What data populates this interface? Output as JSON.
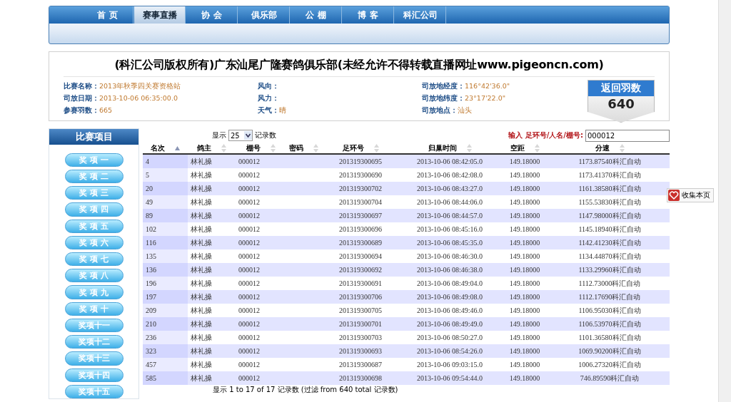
{
  "nav": [
    {
      "label": "首 页",
      "selected": false
    },
    {
      "label": "赛事直播",
      "selected": true
    },
    {
      "label": "协 会",
      "selected": false
    },
    {
      "label": "俱乐部",
      "selected": false
    },
    {
      "label": "公 棚",
      "selected": false
    },
    {
      "label": "博 客",
      "selected": false
    },
    {
      "label": "科汇公司",
      "selected": false
    }
  ],
  "header": {
    "title": "(科汇公司版权所有)广东汕尾广隆赛鸽俱乐部(未经允许不得转载直播网址www.pigeoncn.com)",
    "info": [
      {
        "label": "比赛名称：",
        "value": "2013年秋季四关赛资格站"
      },
      {
        "label": "风向："
      },
      {
        "label": "司放地经度：",
        "value": "116°42'36.0\""
      },
      {
        "label": "司放日期：",
        "value": "2013-10-06 06:35:00.0"
      },
      {
        "label": "风力："
      },
      {
        "label": "司放地纬度：",
        "value": "23°17'22.0\""
      },
      {
        "label": "参赛羽数：",
        "value": "665"
      },
      {
        "label": "天气：",
        "value": "晴"
      },
      {
        "label": "司放地点：",
        "value": "汕头"
      }
    ],
    "badge": {
      "title": "返回羽数",
      "count": "640"
    }
  },
  "sidebar": {
    "title": "比赛项目",
    "items": [
      "奖 项 一",
      "奖 项 二",
      "奖 项 三",
      "奖 项 四",
      "奖 项 五",
      "奖 项 六",
      "奖 项 七",
      "奖 项 八",
      "奖 项 九",
      "奖 项 十",
      "奖项十一",
      "奖项十二",
      "奖项十三",
      "奖项十四",
      "奖项十五"
    ]
  },
  "table": {
    "length_label_before": "显示",
    "length_value": "25",
    "length_label_after": "记录数",
    "search_label": "输入 足环号/人名/棚号:",
    "search_value": "000012",
    "columns": [
      {
        "label": "名次",
        "sorted": true
      },
      {
        "label": "鸽主",
        "sorted": false
      },
      {
        "label": "棚号",
        "sorted": false
      },
      {
        "label": "密码",
        "sorted": false
      },
      {
        "label": "足环号",
        "sorted": false
      },
      {
        "label": "归巢时间",
        "sorted": false
      },
      {
        "label": "空距",
        "sorted": false
      },
      {
        "label": "分速",
        "sorted": false
      }
    ],
    "rows": [
      {
        "rank": "4",
        "owner": "林礼操",
        "pen": "000012",
        "ring": "201319300695",
        "time": "2013-10-06 08:42:05.0",
        "distance": "149.18000",
        "speed": "1173.87540科汇自动"
      },
      {
        "rank": "5",
        "owner": "林礼操",
        "pen": "000012",
        "ring": "201319300690",
        "time": "2013-10-06 08:42:08.0",
        "distance": "149.18000",
        "speed": "1173.41370科汇自动"
      },
      {
        "rank": "20",
        "owner": "林礼操",
        "pen": "000012",
        "ring": "201319300702",
        "time": "2013-10-06 08:43:27.0",
        "distance": "149.18000",
        "speed": "1161.38580科汇自动"
      },
      {
        "rank": "49",
        "owner": "林礼操",
        "pen": "000012",
        "ring": "201319300704",
        "time": "2013-10-06 08:44:06.0",
        "distance": "149.18000",
        "speed": "1155.53830科汇自动"
      },
      {
        "rank": "89",
        "owner": "林礼操",
        "pen": "000012",
        "ring": "201319300697",
        "time": "2013-10-06 08:44:57.0",
        "distance": "149.18000",
        "speed": "1147.98000科汇自动"
      },
      {
        "rank": "102",
        "owner": "林礼操",
        "pen": "000012",
        "ring": "201319300696",
        "time": "2013-10-06 08:45:16.0",
        "distance": "149.18000",
        "speed": "1145.18940科汇自动"
      },
      {
        "rank": "116",
        "owner": "林礼操",
        "pen": "000012",
        "ring": "201319300689",
        "time": "2013-10-06 08:45:35.0",
        "distance": "149.18000",
        "speed": "1142.41230科汇自动"
      },
      {
        "rank": "135",
        "owner": "林礼操",
        "pen": "000012",
        "ring": "201319300694",
        "time": "2013-10-06 08:46:30.0",
        "distance": "149.18000",
        "speed": "1134.44870科汇自动"
      },
      {
        "rank": "136",
        "owner": "林礼操",
        "pen": "000012",
        "ring": "201319300692",
        "time": "2013-10-06 08:46:38.0",
        "distance": "149.18000",
        "speed": "1133.29960科汇自动"
      },
      {
        "rank": "196",
        "owner": "林礼操",
        "pen": "000012",
        "ring": "201319300691",
        "time": "2013-10-06 08:49:04.0",
        "distance": "149.18000",
        "speed": "1112.73000科汇自动"
      },
      {
        "rank": "197",
        "owner": "林礼操",
        "pen": "000012",
        "ring": "201319300706",
        "time": "2013-10-06 08:49:08.0",
        "distance": "149.18000",
        "speed": "1112.17690科汇自动"
      },
      {
        "rank": "209",
        "owner": "林礼操",
        "pen": "000012",
        "ring": "201319300705",
        "time": "2013-10-06 08:49:46.0",
        "distance": "149.18000",
        "speed": "1106.95030科汇自动"
      },
      {
        "rank": "210",
        "owner": "林礼操",
        "pen": "000012",
        "ring": "201319300701",
        "time": "2013-10-06 08:49:49.0",
        "distance": "149.18000",
        "speed": "1106.53970科汇自动"
      },
      {
        "rank": "236",
        "owner": "林礼操",
        "pen": "000012",
        "ring": "201319300703",
        "time": "2013-10-06 08:50:27.0",
        "distance": "149.18000",
        "speed": "1101.36580科汇自动"
      },
      {
        "rank": "323",
        "owner": "林礼操",
        "pen": "000012",
        "ring": "201319300693",
        "time": "2013-10-06 08:54:26.0",
        "distance": "149.18000",
        "speed": "1069.90200科汇自动"
      },
      {
        "rank": "457",
        "owner": "林礼操",
        "pen": "000012",
        "ring": "201319300687",
        "time": "2013-10-06 09:03:15.0",
        "distance": "149.18000",
        "speed": "1006.27320科汇自动"
      },
      {
        "rank": "585",
        "owner": "林礼操",
        "pen": "000012",
        "ring": "201319300698",
        "time": "2013-10-06 09:54:44.0",
        "distance": "149.18000",
        "speed": "746.89590科汇自动"
      }
    ],
    "info": "显示 1 to 17 of 17 记录数 (过滤 from 640 total 记录数)"
  },
  "bookmark": "收集本页"
}
